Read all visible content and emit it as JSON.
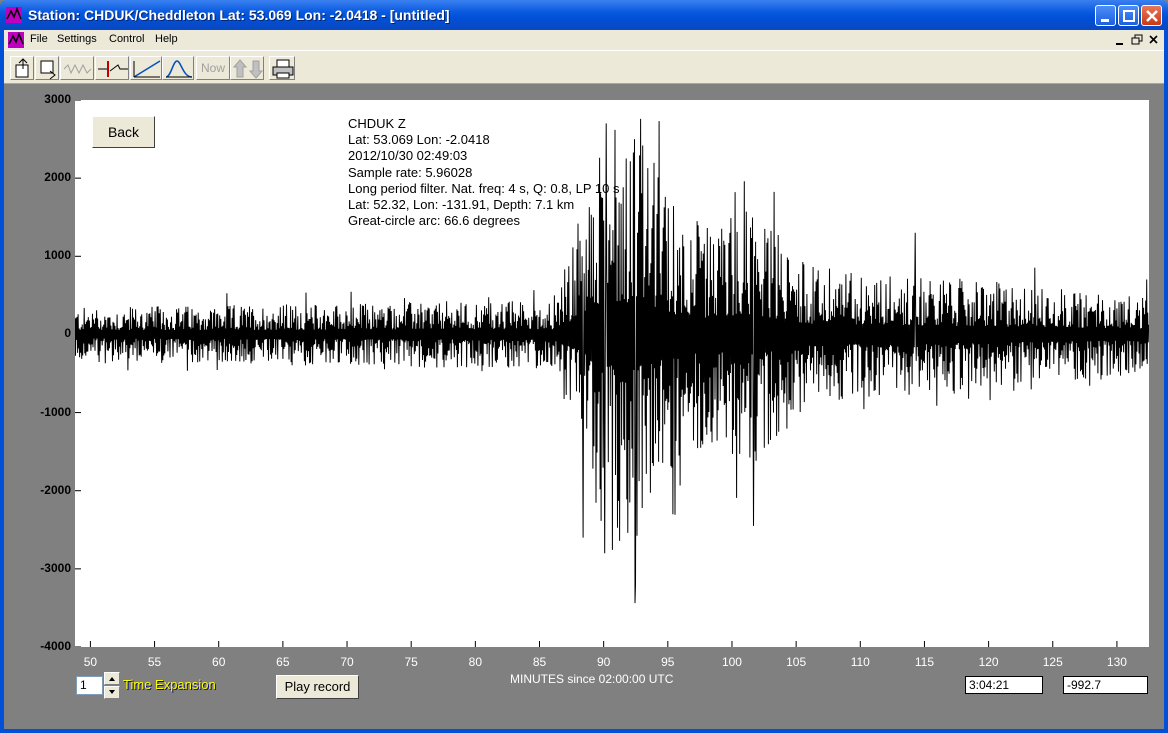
{
  "window": {
    "title": "Station: CHDUK/Cheddleton Lat: 53.069 Lon: -2.0418 - [untitled]"
  },
  "menu": {
    "items": [
      "File",
      "Settings",
      "Control",
      "Help"
    ]
  },
  "toolbar": {
    "now_label": "Now"
  },
  "plot": {
    "back_label": "Back",
    "info_lines": [
      "CHDUK  Z",
      "Lat: 53.069 Lon: -2.0418",
      "2012/10/30 02:49:03",
      "Sample rate: 5.96028",
      "Long period filter. Nat. freq: 4 s, Q: 0.8, LP 10 s",
      "Lat: 52.32, Lon: -131.91, Depth: 7.1 km",
      "Great-circle arc: 66.6 degrees"
    ]
  },
  "controls": {
    "time_expansion_value": "1",
    "time_expansion_label": "Time Expansion",
    "play_label": "Play record",
    "time_readout": "3:04:21",
    "value_readout": "-992.7"
  },
  "chart_data": {
    "type": "line",
    "xlabel": "MINUTES since 02:00:00 UTC",
    "ylabel": "",
    "xlim": [
      48.8,
      132.5
    ],
    "ylim": [
      -4000,
      3000
    ],
    "xticks": [
      50,
      55,
      60,
      65,
      70,
      75,
      80,
      85,
      90,
      95,
      100,
      105,
      110,
      115,
      120,
      125,
      130
    ],
    "yticks": [
      3000,
      2000,
      1000,
      0,
      -1000,
      -2000,
      -3000,
      -4000
    ],
    "grid": false,
    "series": [
      {
        "color": "#000000",
        "envelope": [
          {
            "x": 48.8,
            "amp": 350
          },
          {
            "x": 86,
            "amp": 450
          },
          {
            "x": 88,
            "amp": 1300
          },
          {
            "x": 90,
            "amp": 2600
          },
          {
            "x": 92.5,
            "amp": 2800
          },
          {
            "x": 95,
            "amp": 1800
          },
          {
            "x": 98,
            "amp": 1400
          },
          {
            "x": 101.5,
            "amp": 1700
          },
          {
            "x": 106,
            "amp": 900
          },
          {
            "x": 112,
            "amp": 800
          },
          {
            "x": 132.5,
            "amp": 500
          }
        ],
        "peaks": [
          {
            "x": 88.4,
            "y": -2600
          },
          {
            "x": 90.2,
            "y": 2700
          },
          {
            "x": 90.1,
            "y": -2800
          },
          {
            "x": 92.4,
            "y": 2500
          },
          {
            "x": 92.5,
            "y": -3200
          },
          {
            "x": 95.4,
            "y": -2300
          },
          {
            "x": 101.7,
            "y": -2450
          },
          {
            "x": 114.3,
            "y": 1300
          }
        ]
      }
    ]
  }
}
